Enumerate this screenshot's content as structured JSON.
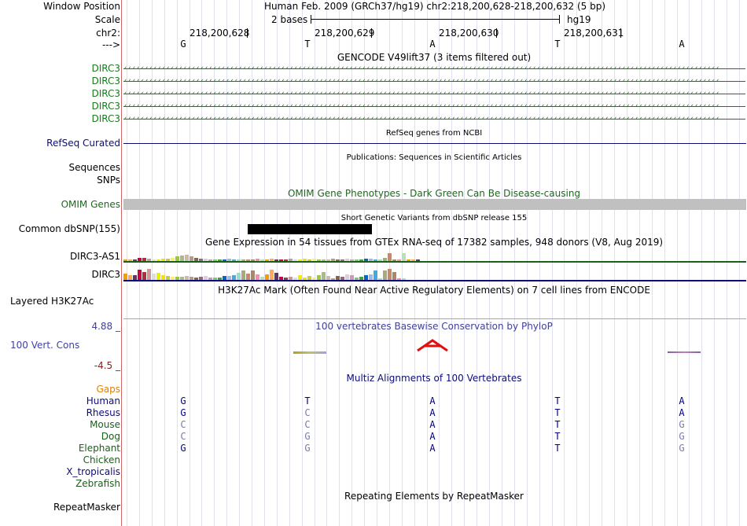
{
  "labels": {
    "window_position": "Window Position",
    "scale": "Scale",
    "chrom": "chr2:",
    "strand": "--->",
    "gencode_tracks": [
      "DIRC3",
      "DIRC3",
      "DIRC3",
      "DIRC3",
      "DIRC3"
    ],
    "refseq": "RefSeq Curated",
    "sequences": "Sequences",
    "snps": "SNPs",
    "omim": "OMIM Genes",
    "dbsnp": "Common dbSNP(155)",
    "gtex": [
      "DIRC3-AS1",
      "DIRC3"
    ],
    "h3k27ac": "Layered H3K27Ac",
    "phylop_max": "4.88 _",
    "cons": "100 Vert. Cons",
    "phylop_min": "-4.5 _",
    "gaps": "Gaps",
    "species": [
      "Human",
      "Rhesus",
      "Mouse",
      "Dog",
      "Elephant",
      "Chicken",
      "X_tropicalis",
      "Zebrafish"
    ],
    "repeatmasker": "RepeatMasker"
  },
  "header": {
    "position": "Human Feb. 2009 (GRCh37/hg19)   chr2:218,200,628-218,200,632 (5 bp)",
    "scale_text": "2 bases",
    "assembly": "hg19",
    "coords": [
      "218,200,628",
      "218,200,629",
      "218,200,630",
      "218,200,631"
    ],
    "bases": [
      "G",
      "T",
      "A",
      "T",
      "A"
    ]
  },
  "titles": {
    "gencode": "GENCODE V49lift37 (3 items filtered out)",
    "refseq": "RefSeq genes from NCBI",
    "pubs": "Publications: Sequences in Scientific Articles",
    "omim": "OMIM Gene Phenotypes - Dark Green Can Be Disease-causing",
    "dbsnp": "Short Genetic Variants from dbSNP release 155",
    "gtex": "Gene Expression in 54 tissues from GTEx RNA-seq of 17382 samples, 948 donors (V8, Aug 2019)",
    "h3k27ac": "H3K27Ac Mark (Often Found Near Active Regulatory Elements) on 7 cell lines from ENCODE",
    "phylop": "100 vertebrates Basewise Conservation by PhyloP",
    "multiz": "Multiz Alignments of 100 Vertebrates",
    "rmsk": "Repeating Elements by RepeatMasker"
  },
  "alignment": [
    [
      "G",
      "T",
      "A",
      "T",
      "A"
    ],
    [
      "G",
      "C",
      "A",
      "T",
      "A"
    ],
    [
      "C",
      "C",
      "A",
      "T",
      "G"
    ],
    [
      "C",
      "G",
      "A",
      "T",
      "G"
    ],
    [
      "G",
      "G",
      "A",
      "T",
      "G"
    ]
  ],
  "colors": {
    "gencode_green": "#1a7a1a",
    "refseq_navy": "#0c0c78",
    "omim_green": "#1b6b1b",
    "phylop_blue": "#4040a0",
    "phylop_min": "#8b1a1a",
    "gaps_orange": "#e08000",
    "species_green": "#1b5e1b",
    "conserved": "#000080",
    "mismatch": "#7a7aa8",
    "arrow_red": "#e01010"
  }
}
